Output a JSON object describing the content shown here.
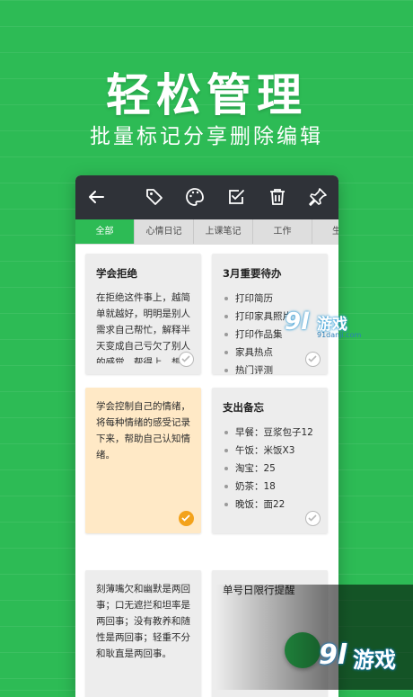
{
  "promo": {
    "headline": "轻松管理",
    "subline": "批量标记分享删除编辑"
  },
  "toolbar": {
    "icons": [
      "back-arrow-icon",
      "tag-icon",
      "palette-icon",
      "checkbox-icon",
      "trash-icon",
      "pin-icon"
    ]
  },
  "tabs": [
    {
      "label": "全部",
      "active": true
    },
    {
      "label": "心情日记",
      "active": false
    },
    {
      "label": "上课笔记",
      "active": false
    },
    {
      "label": "工作",
      "active": false
    },
    {
      "label": "生",
      "active": false
    }
  ],
  "cards": {
    "c1": {
      "title": "学会拒绝",
      "body": "在拒绝这件事上，越简单就越好，明明是别人需求自己帮忙，解释半天变成自己亏欠了别人的感觉，帮得上，想帮就帮，帮不上，就拒绝"
    },
    "c2": {
      "title": "3月重要待办",
      "items": [
        "打印简历",
        "打印家具照片",
        "打印作品集",
        "家具热点",
        "热门评测"
      ]
    },
    "c3": {
      "body": "学会控制自己的情绪，将每种情绪的感受记录下来，帮助自己认知情绪。"
    },
    "c4": {
      "title": "支出备忘",
      "items": [
        "早餐：豆浆包子12",
        "午饭：米饭X3",
        "淘宝：25",
        "奶茶：18",
        "晚饭：面22"
      ]
    },
    "c5": {
      "body": "刻薄嘴欠和幽默是两回事；口无遮拦和坦率是两回事；没有教养和随性是两回事；轻重不分和耿直是两回事。"
    },
    "c6": {
      "title": "单号日限行提醒"
    }
  },
  "watermark": {
    "logo": "9l",
    "text": "游戏",
    "sub": "91danji.com"
  },
  "colors": {
    "brand_green": "#2dbb55",
    "toolbar": "#2f3238",
    "note_yellow": "#ffe9c6",
    "check_on": "#f3a21b"
  }
}
